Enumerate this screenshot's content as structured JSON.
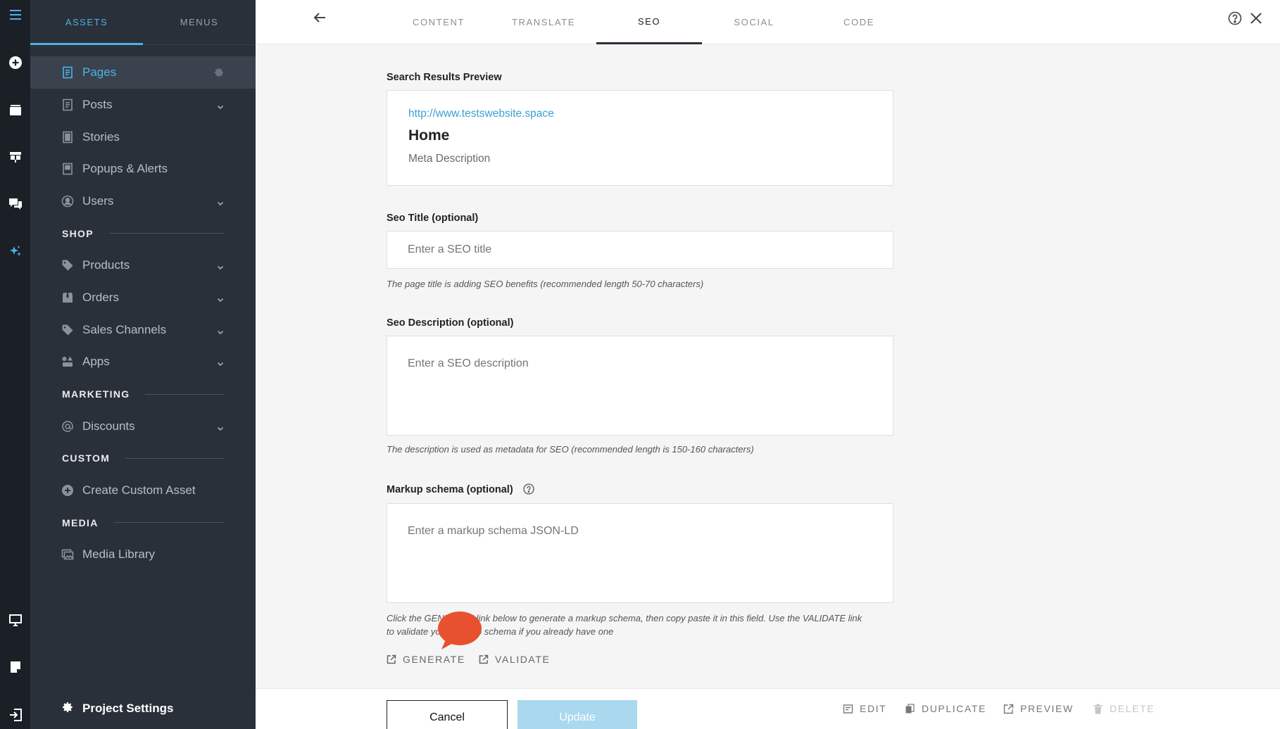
{
  "sidebar": {
    "tabs": [
      {
        "label": "ASSETS",
        "active": true
      },
      {
        "label": "MENUS",
        "active": false
      }
    ],
    "items": [
      {
        "label": "Pages",
        "icon": "page-icon",
        "active": true
      },
      {
        "label": "Posts",
        "icon": "page-icon",
        "expandable": true
      },
      {
        "label": "Stories",
        "icon": "page-icon"
      },
      {
        "label": "Popups & Alerts",
        "icon": "page-icon"
      },
      {
        "label": "Users",
        "icon": "user-circle-icon",
        "expandable": true
      }
    ],
    "sections": {
      "shop": {
        "title": "SHOP",
        "items": [
          {
            "label": "Products",
            "icon": "tag-icon"
          },
          {
            "label": "Orders",
            "icon": "box-icon"
          },
          {
            "label": "Sales Channels",
            "icon": "tag-icon"
          },
          {
            "label": "Apps",
            "icon": "shapes-icon"
          }
        ]
      },
      "marketing": {
        "title": "MARKETING",
        "items": [
          {
            "label": "Discounts",
            "icon": "at-icon"
          }
        ]
      },
      "custom": {
        "title": "CUSTOM",
        "items": [
          {
            "label": "Create Custom Asset",
            "icon": "plus-circle-icon"
          }
        ]
      },
      "media": {
        "title": "MEDIA",
        "items": [
          {
            "label": "Media Library",
            "icon": "image-icon"
          }
        ]
      }
    },
    "project_settings": "Project Settings"
  },
  "topbar": {
    "tabs": [
      "CONTENT",
      "TRANSLATE",
      "SEO",
      "SOCIAL",
      "CODE"
    ],
    "active_tab": "SEO"
  },
  "form": {
    "preview_label": "Search Results Preview",
    "preview": {
      "url": "http://www.testswebsite.space",
      "title": "Home",
      "description": "Meta Description"
    },
    "seo_title": {
      "label": "Seo Title (optional)",
      "placeholder": "Enter a SEO title",
      "value": "",
      "hint": "The page title is adding SEO benefits (recommended length 50-70 characters)"
    },
    "seo_description": {
      "label": "Seo Description (optional)",
      "placeholder": "Enter a SEO description",
      "value": "",
      "hint": "The description is used as metadata for SEO (recommended length is 150-160 characters)"
    },
    "markup_schema": {
      "label": "Markup schema (optional)",
      "placeholder": "Enter a markup schema JSON-LD",
      "value": "",
      "hint_line1": "Click the GENERATE link below to generate a markup schema, then copy paste it in this field. Use the VALIDATE link",
      "hint_line2": "to validate your markup schema if you already have one"
    },
    "generate_label": "GENERATE",
    "validate_label": "VALIDATE"
  },
  "bottombar": {
    "cancel": "Cancel",
    "update": "Update",
    "edit": "EDIT",
    "duplicate": "DUPLICATE",
    "preview": "PREVIEW",
    "delete": "DELETE"
  },
  "colors": {
    "accent": "#4ab3e6",
    "rail_bg": "#1b2027",
    "sidebar_bg": "#2a3039",
    "bubble": "#e8512f"
  }
}
